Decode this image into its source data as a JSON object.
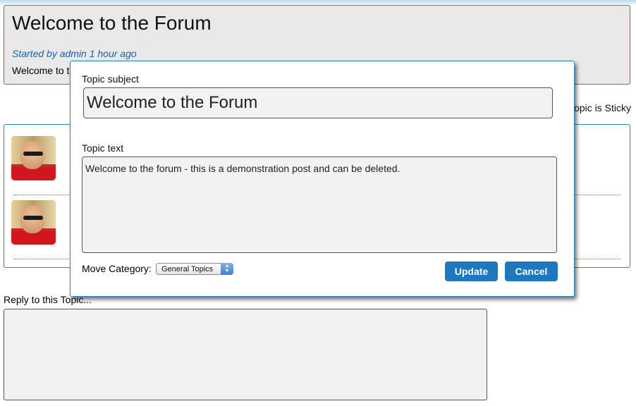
{
  "topic": {
    "title": "Welcome to the Forum",
    "meta": "Started by admin 1 hour ago",
    "preview": "Welcome to t",
    "sticky_label": "Topic is Sticky"
  },
  "reply": {
    "label": "Reply to this Topic..."
  },
  "edit_dialog": {
    "subject_label": "Topic subject",
    "subject_value": "Welcome to the Forum",
    "text_label": "Topic text",
    "text_value": "Welcome to the forum - this is a demonstration post and can be deleted.",
    "move_category_label": "Move Category:",
    "category_selected": "General Topics",
    "update_label": "Update",
    "cancel_label": "Cancel"
  },
  "colors": {
    "accent": "#2f86b6",
    "button": "#1f77bd",
    "meta_text": "#1f5fa7"
  }
}
